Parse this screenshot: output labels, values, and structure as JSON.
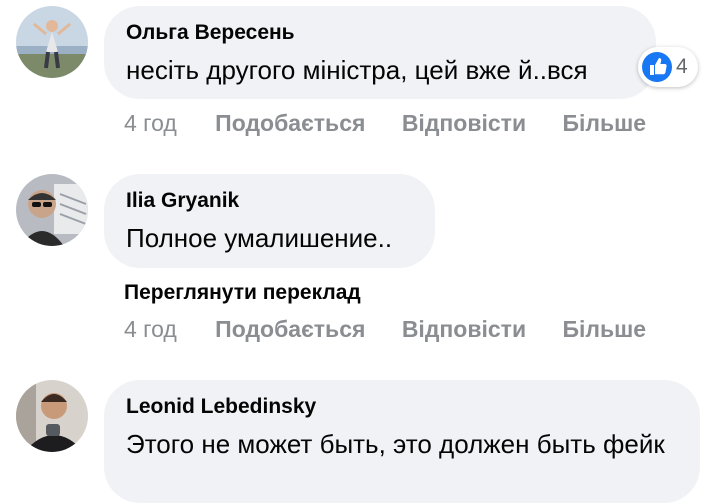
{
  "comments": [
    {
      "author": "Ольга Вересень",
      "text": "несіть другого міністра, цей вже й..вся",
      "time": "4 год",
      "like_label": "Подобається",
      "reply_label": "Відповісти",
      "more_label": "Більше",
      "reaction_icon": "like-icon",
      "reaction_count": "4"
    },
    {
      "author": "Ilia Gryanik",
      "text": "Полное умалишение..",
      "translate_label": "Переглянути переклад",
      "time": "4 год",
      "like_label": "Подобається",
      "reply_label": "Відповісти",
      "more_label": "Більше"
    },
    {
      "author": "Leonid Lebedinsky",
      "text": "Этого не может быть, это должен быть фейк"
    }
  ],
  "colors": {
    "bubble": "#f0f2f5",
    "muted": "#8a8d91",
    "like_blue": "#1877f2"
  }
}
